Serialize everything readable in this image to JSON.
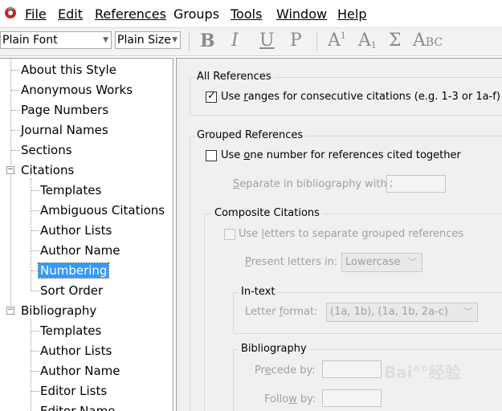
{
  "menu": {
    "file": "File",
    "edit": "Edit",
    "references": "References",
    "groups": "Groups",
    "tools": "Tools",
    "window": "Window",
    "help": "Help"
  },
  "toolbar": {
    "font": "Plain Font",
    "size": "Plain Size",
    "bold": "B",
    "italic": "I",
    "underline": "U",
    "plain": "P",
    "superscript": "A",
    "superscript_mark": "1",
    "subscript": "A",
    "subscript_mark": "1",
    "symbol": "Σ",
    "smallcaps": "A",
    "smallcaps_rest": "BC"
  },
  "tree": {
    "about": "About this Style",
    "anonymous": "Anonymous Works",
    "page_numbers": "Page Numbers",
    "journal_names": "Journal Names",
    "sections": "Sections",
    "citations": "Citations",
    "cit_templates": "Templates",
    "cit_ambiguous": "Ambiguous Citations",
    "cit_author_lists": "Author Lists",
    "cit_author_name": "Author Name",
    "cit_numbering": "Numbering",
    "cit_sort_order": "Sort Order",
    "bibliography": "Bibliography",
    "bib_templates": "Templates",
    "bib_author_lists": "Author Lists",
    "bib_author_name": "Author Name",
    "bib_editor_lists": "Editor Lists",
    "bib_editor_name": "Editor Name"
  },
  "panel": {
    "all_refs_legend": "All References",
    "use_ranges_checked": true,
    "use_ranges_pre": "Use ",
    "use_ranges_key": "r",
    "use_ranges_post": "anges for consecutive citations (e.g. 1-3 or 1a-f)",
    "grouped_legend": "Grouped References",
    "one_number_pre": "Use ",
    "one_number_key": "o",
    "one_number_post": "ne number for references cited together",
    "separate_key": "S",
    "separate_post": "eparate in bibliography with:",
    "separate_value": ";",
    "composite_legend": "Composite Citations",
    "letters_pre": "Use ",
    "letters_key": "l",
    "letters_post": "etters to separate grouped references",
    "present_key": "P",
    "present_post": "resent letters in:",
    "present_value": "Lowercase",
    "intext_legend": "In-text",
    "letter_format_pre": "Letter ",
    "letter_format_key": "f",
    "letter_format_post": "ormat:",
    "letter_format_value": "(1a, 1b), (1a, 1b, 2a-c)",
    "bibliography_legend": "Bibliography",
    "precede_pre": "Pr",
    "precede_key": "e",
    "precede_post": "cede by:",
    "follow_pre": "Follo",
    "follow_key": "w",
    "follow_post": " by:"
  },
  "watermark": "Bai°°经验"
}
